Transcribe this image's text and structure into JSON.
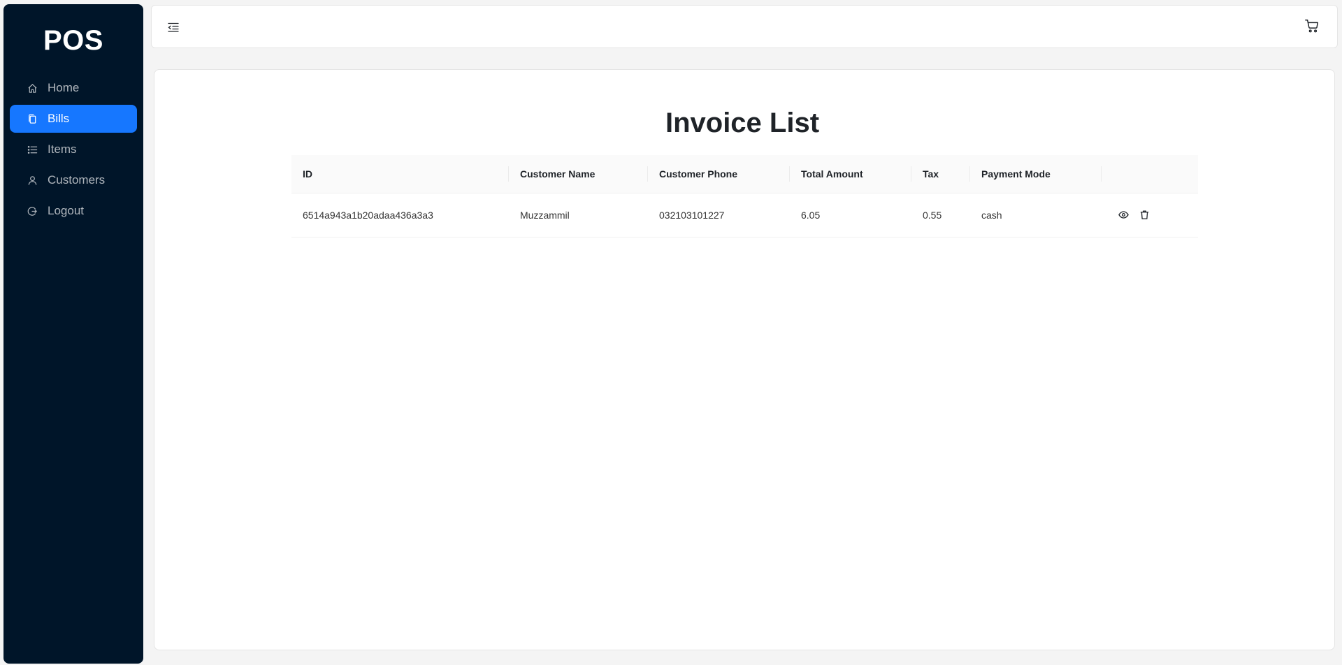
{
  "app": {
    "logo": "POS"
  },
  "sidebar": {
    "items": [
      {
        "label": "Home",
        "icon": "home-icon"
      },
      {
        "label": "Bills",
        "icon": "copy-icon",
        "active": true
      },
      {
        "label": "Items",
        "icon": "list-icon"
      },
      {
        "label": "Customers",
        "icon": "user-icon"
      },
      {
        "label": "Logout",
        "icon": "logout-icon"
      }
    ]
  },
  "header": {
    "toggle_icon": "menu-fold-icon",
    "cart_icon": "cart-icon"
  },
  "main": {
    "title": "Invoice List",
    "table": {
      "columns": [
        "ID",
        "Customer Name",
        "Customer Phone",
        "Total Amount",
        "Tax",
        "Payment Mode",
        ""
      ],
      "rows": [
        {
          "id": "6514a943a1b20adaa436a3a3",
          "customer_name": "Muzzammil",
          "customer_phone": "032103101227",
          "total_amount": "6.05",
          "tax": "0.55",
          "payment_mode": "cash"
        }
      ]
    }
  },
  "colors": {
    "sidebar_bg": "#001529",
    "accent": "#1677ff",
    "page_bg": "#f4f4f4"
  }
}
